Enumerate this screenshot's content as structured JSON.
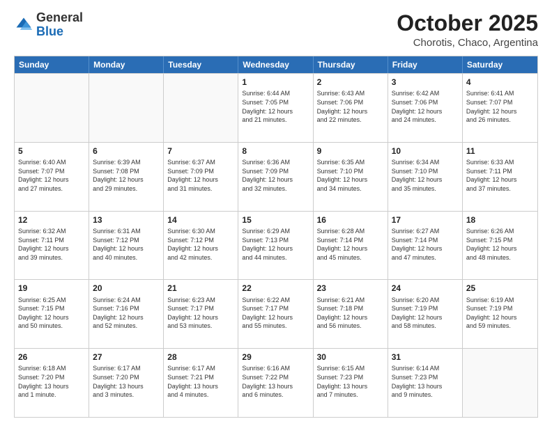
{
  "logo": {
    "general": "General",
    "blue": "Blue"
  },
  "header": {
    "month": "October 2025",
    "location": "Chorotis, Chaco, Argentina"
  },
  "days": [
    "Sunday",
    "Monday",
    "Tuesday",
    "Wednesday",
    "Thursday",
    "Friday",
    "Saturday"
  ],
  "weeks": [
    [
      {
        "day": "",
        "info": ""
      },
      {
        "day": "",
        "info": ""
      },
      {
        "day": "",
        "info": ""
      },
      {
        "day": "1",
        "info": "Sunrise: 6:44 AM\nSunset: 7:05 PM\nDaylight: 12 hours\nand 21 minutes."
      },
      {
        "day": "2",
        "info": "Sunrise: 6:43 AM\nSunset: 7:06 PM\nDaylight: 12 hours\nand 22 minutes."
      },
      {
        "day": "3",
        "info": "Sunrise: 6:42 AM\nSunset: 7:06 PM\nDaylight: 12 hours\nand 24 minutes."
      },
      {
        "day": "4",
        "info": "Sunrise: 6:41 AM\nSunset: 7:07 PM\nDaylight: 12 hours\nand 26 minutes."
      }
    ],
    [
      {
        "day": "5",
        "info": "Sunrise: 6:40 AM\nSunset: 7:07 PM\nDaylight: 12 hours\nand 27 minutes."
      },
      {
        "day": "6",
        "info": "Sunrise: 6:39 AM\nSunset: 7:08 PM\nDaylight: 12 hours\nand 29 minutes."
      },
      {
        "day": "7",
        "info": "Sunrise: 6:37 AM\nSunset: 7:09 PM\nDaylight: 12 hours\nand 31 minutes."
      },
      {
        "day": "8",
        "info": "Sunrise: 6:36 AM\nSunset: 7:09 PM\nDaylight: 12 hours\nand 32 minutes."
      },
      {
        "day": "9",
        "info": "Sunrise: 6:35 AM\nSunset: 7:10 PM\nDaylight: 12 hours\nand 34 minutes."
      },
      {
        "day": "10",
        "info": "Sunrise: 6:34 AM\nSunset: 7:10 PM\nDaylight: 12 hours\nand 35 minutes."
      },
      {
        "day": "11",
        "info": "Sunrise: 6:33 AM\nSunset: 7:11 PM\nDaylight: 12 hours\nand 37 minutes."
      }
    ],
    [
      {
        "day": "12",
        "info": "Sunrise: 6:32 AM\nSunset: 7:11 PM\nDaylight: 12 hours\nand 39 minutes."
      },
      {
        "day": "13",
        "info": "Sunrise: 6:31 AM\nSunset: 7:12 PM\nDaylight: 12 hours\nand 40 minutes."
      },
      {
        "day": "14",
        "info": "Sunrise: 6:30 AM\nSunset: 7:12 PM\nDaylight: 12 hours\nand 42 minutes."
      },
      {
        "day": "15",
        "info": "Sunrise: 6:29 AM\nSunset: 7:13 PM\nDaylight: 12 hours\nand 44 minutes."
      },
      {
        "day": "16",
        "info": "Sunrise: 6:28 AM\nSunset: 7:14 PM\nDaylight: 12 hours\nand 45 minutes."
      },
      {
        "day": "17",
        "info": "Sunrise: 6:27 AM\nSunset: 7:14 PM\nDaylight: 12 hours\nand 47 minutes."
      },
      {
        "day": "18",
        "info": "Sunrise: 6:26 AM\nSunset: 7:15 PM\nDaylight: 12 hours\nand 48 minutes."
      }
    ],
    [
      {
        "day": "19",
        "info": "Sunrise: 6:25 AM\nSunset: 7:15 PM\nDaylight: 12 hours\nand 50 minutes."
      },
      {
        "day": "20",
        "info": "Sunrise: 6:24 AM\nSunset: 7:16 PM\nDaylight: 12 hours\nand 52 minutes."
      },
      {
        "day": "21",
        "info": "Sunrise: 6:23 AM\nSunset: 7:17 PM\nDaylight: 12 hours\nand 53 minutes."
      },
      {
        "day": "22",
        "info": "Sunrise: 6:22 AM\nSunset: 7:17 PM\nDaylight: 12 hours\nand 55 minutes."
      },
      {
        "day": "23",
        "info": "Sunrise: 6:21 AM\nSunset: 7:18 PM\nDaylight: 12 hours\nand 56 minutes."
      },
      {
        "day": "24",
        "info": "Sunrise: 6:20 AM\nSunset: 7:19 PM\nDaylight: 12 hours\nand 58 minutes."
      },
      {
        "day": "25",
        "info": "Sunrise: 6:19 AM\nSunset: 7:19 PM\nDaylight: 12 hours\nand 59 minutes."
      }
    ],
    [
      {
        "day": "26",
        "info": "Sunrise: 6:18 AM\nSunset: 7:20 PM\nDaylight: 13 hours\nand 1 minute."
      },
      {
        "day": "27",
        "info": "Sunrise: 6:17 AM\nSunset: 7:20 PM\nDaylight: 13 hours\nand 3 minutes."
      },
      {
        "day": "28",
        "info": "Sunrise: 6:17 AM\nSunset: 7:21 PM\nDaylight: 13 hours\nand 4 minutes."
      },
      {
        "day": "29",
        "info": "Sunrise: 6:16 AM\nSunset: 7:22 PM\nDaylight: 13 hours\nand 6 minutes."
      },
      {
        "day": "30",
        "info": "Sunrise: 6:15 AM\nSunset: 7:23 PM\nDaylight: 13 hours\nand 7 minutes."
      },
      {
        "day": "31",
        "info": "Sunrise: 6:14 AM\nSunset: 7:23 PM\nDaylight: 13 hours\nand 9 minutes."
      },
      {
        "day": "",
        "info": ""
      }
    ]
  ]
}
